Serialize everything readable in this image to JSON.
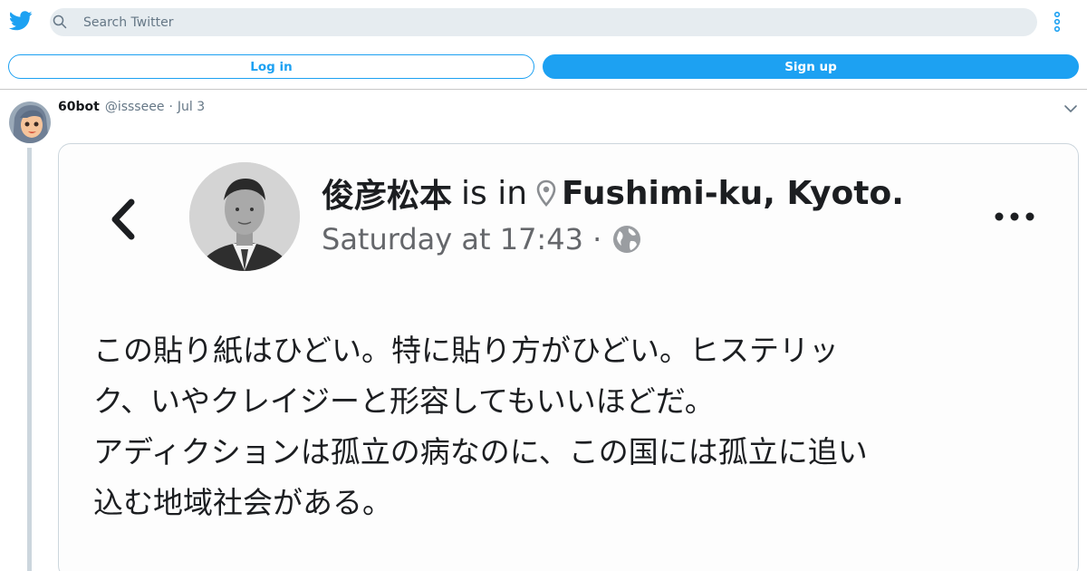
{
  "topbar": {
    "search_placeholder": "Search Twitter"
  },
  "auth": {
    "login_label": "Log in",
    "signup_label": "Sign up"
  },
  "tweet": {
    "name": "60bot",
    "handle": "@issseee",
    "separator": "·",
    "time": "Jul 3"
  },
  "media": {
    "fb_name": "俊彦松本",
    "fb_is_in": "is in",
    "fb_location": "Fushimi-ku, Kyoto",
    "fb_period": ".",
    "fb_timestamp": "Saturday at 17:43 ·",
    "fb_lines": [
      "この貼り紙はひどい。特に貼り方がひどい。ヒステリッ",
      "ク、いやクレイジーと形容してもいいほどだ。",
      "アディクションは孤立の病なのに、この国には孤立に追い",
      "込む地域社会がある。"
    ]
  },
  "colors": {
    "accent": "#1da1f2",
    "secondary_text": "#657786",
    "search_bg": "#e6ecf0",
    "thread_line": "#ccd6dd"
  },
  "icons": [
    "twitter-logo-icon",
    "search-icon",
    "more-vertical-icon",
    "chevron-down-icon",
    "back-arrow-icon",
    "location-pin-icon",
    "globe-icon",
    "more-horizontal-icon"
  ]
}
